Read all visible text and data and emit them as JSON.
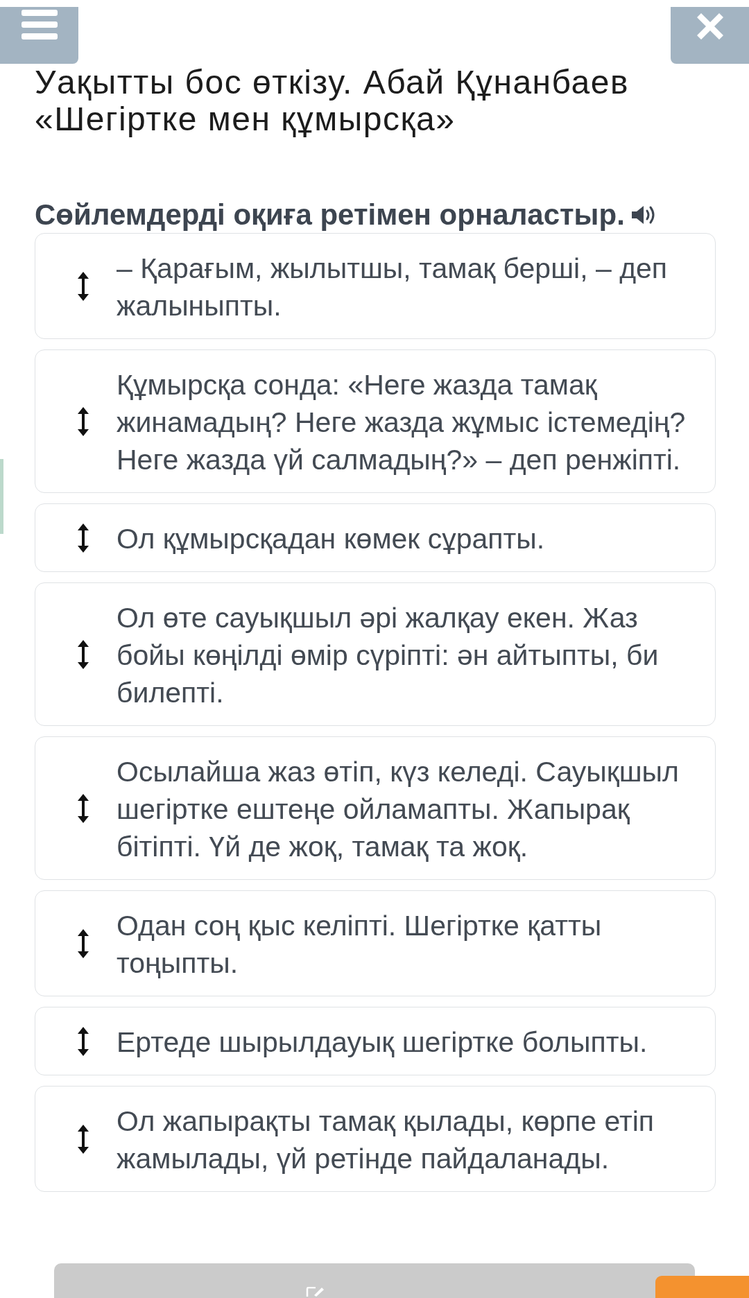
{
  "title": "Уақытты бос өткізу. Абай Құнанбаев «Шегіртке мен құмырсқа»",
  "instruction": "Сөйлемдерді оқиға ретімен орналастыр.",
  "sentences": [
    "– Қарағым, жылытшы, тамақ берші, – деп жалыныпты.",
    "Құмырсқа сонда: «Неге жазда тамақ жинамадың? Неге жазда жұмыс істемедің? Неге жазда үй салмадың?» – деп ренжіпті.",
    "Ол құмырсқадан көмек сұрапты.",
    "Ол өте сауықшыл әрі жалқау екен. Жаз бойы көңілді өмір сүріпті: ән айтыпты, би билепті.",
    "Осылайша жаз өтіп, күз келеді. Сауықшыл шегіртке ештеңе ойламапты. Жапырақ бітіпті. Үй де жоқ, тамақ та жоқ.",
    "Одан соң қыс келіпті. Шегіртке қатты тоңыпты.",
    "Ертеде шырылдауық шегіртке болыпты.",
    "Ол жапырақты тамақ қылады, көрпе етіп жамылады, үй ретінде пайдаланады."
  ]
}
